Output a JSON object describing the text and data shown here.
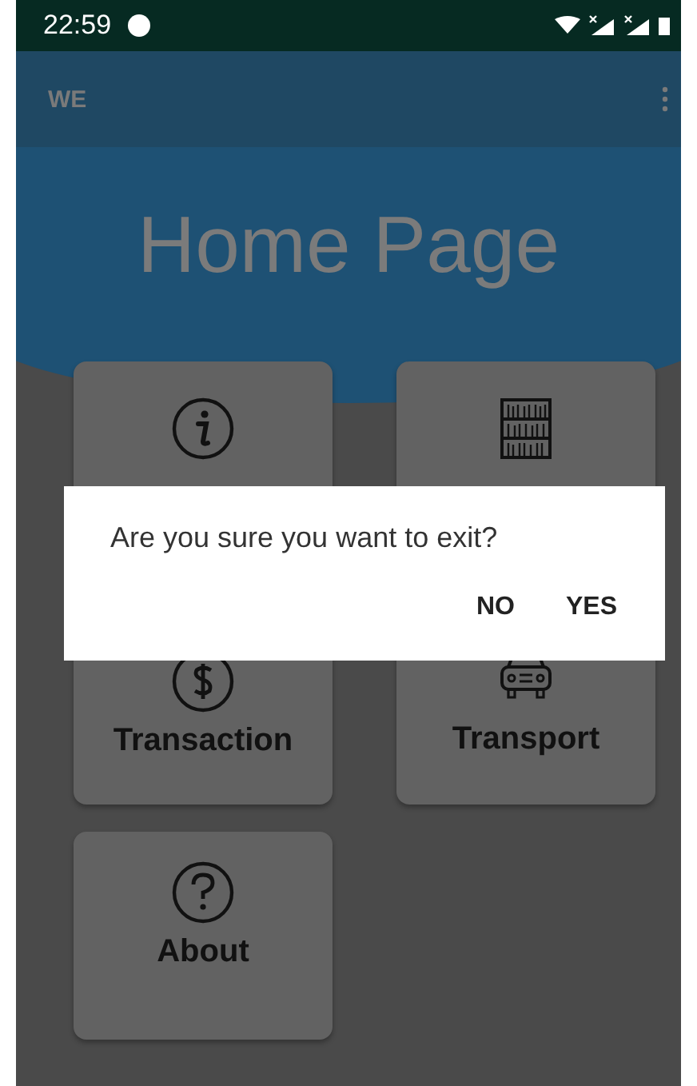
{
  "status_bar": {
    "time": "22:59"
  },
  "app_bar": {
    "title": "WE"
  },
  "header": {
    "title": "Home Page"
  },
  "tiles": [
    {
      "kind": "info"
    },
    {
      "kind": "library"
    },
    {
      "kind": "money",
      "label": "Transaction"
    },
    {
      "kind": "car",
      "label": "Transport"
    },
    {
      "kind": "help",
      "label": "About"
    }
  ],
  "dialog": {
    "message": "Are you sure you want to exit?",
    "buttons": [
      "NO",
      "YES"
    ]
  }
}
